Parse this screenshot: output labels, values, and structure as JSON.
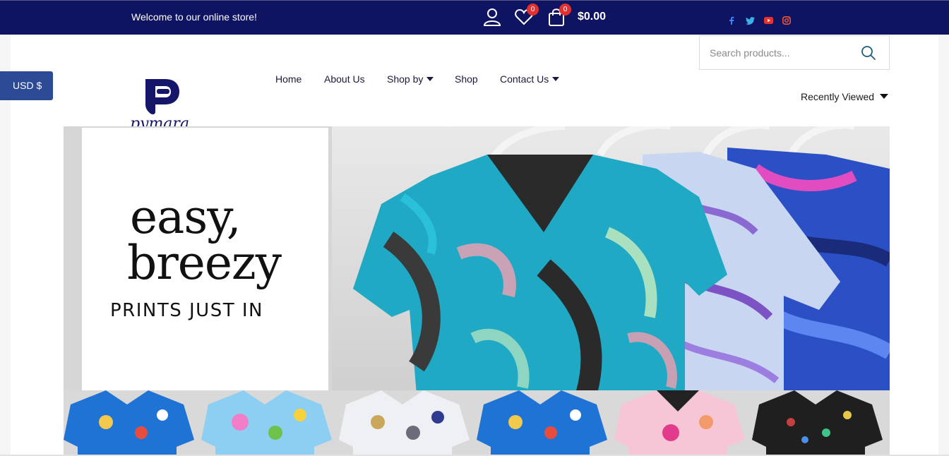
{
  "topbar": {
    "welcome": "Welcome to our online store!",
    "wishlist_count": "0",
    "cart_count": "0",
    "cart_total": "$0.00",
    "icons": [
      "user-icon",
      "heart-icon",
      "bag-icon"
    ],
    "social": [
      "facebook-icon",
      "twitter-icon",
      "youtube-icon",
      "instagram-icon"
    ],
    "background_color": "#0e1462"
  },
  "currency": {
    "label": "USD $",
    "color": "#2d4a95"
  },
  "search": {
    "placeholder": "Search products..."
  },
  "logo": {
    "text": "pymara"
  },
  "nav": {
    "items": [
      {
        "label": "Home"
      },
      {
        "label": "About Us"
      },
      {
        "label": "Shop by"
      },
      {
        "label": "Shop"
      },
      {
        "label": "Contact Us"
      }
    ],
    "recently_viewed": "Recently Viewed"
  },
  "hero": {
    "line1": "easy,",
    "line2": "breezy",
    "line3": "PRINTS JUST IN"
  }
}
